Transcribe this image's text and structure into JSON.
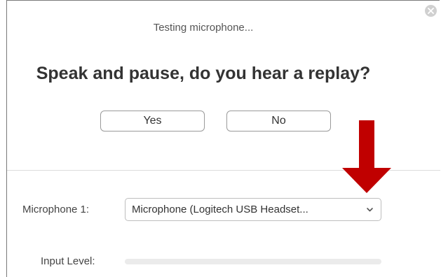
{
  "dialog": {
    "subtitle": "Testing microphone...",
    "question": "Speak and pause, do you hear a replay?",
    "yes_label": "Yes",
    "no_label": "No"
  },
  "settings": {
    "microphone_label": "Microphone 1:",
    "microphone_selected": "Microphone (Logitech USB Headset...",
    "input_level_label": "Input Level:",
    "input_level_value": 0
  },
  "colors": {
    "arrow": "#c00000",
    "close_button": "#d0d0d0"
  },
  "icons": {
    "close": "close-icon",
    "dropdown": "chevron-down-icon",
    "annotation": "down-arrow-icon"
  }
}
